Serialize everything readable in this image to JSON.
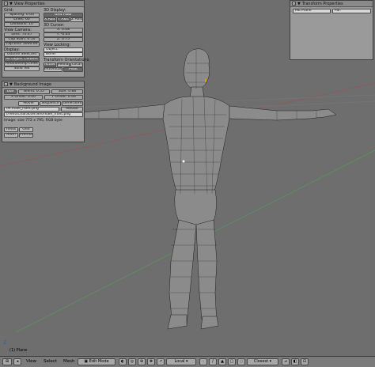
{
  "view_properties": {
    "title": "View Properties",
    "grid_section": "Grid:",
    "spacing": "Spacing: 0.00",
    "lines": "Lines: 60",
    "divisions": "Divisions: 10",
    "view_camera_section": "View Camera:",
    "lens": "Lens: 70.47",
    "clip_start": "Clip Start: 0.10",
    "clip_end": "Clip End: 5000.00",
    "display_section": "Display:",
    "outline_selected": "Outline Selected",
    "all_object_centers": "All Object Centers",
    "relationship_lines": "Relationship Lines",
    "solid_tex": "Solid Tex",
    "display3d_section": "3D Display:",
    "grid_floor": "Grid Floor",
    "x_axis": "X Axis",
    "y_axis": "Y Axis",
    "z_axis": "Z Axis",
    "cursor_section": "3D Cursor:",
    "cursor_x": "X: 0.08",
    "cursor_y": "Y: -0.03",
    "cursor_z": "Z: 0.75",
    "view_locking_section": "View Locking:",
    "object": "Object:",
    "bone": "Bone:",
    "transform_orientations_section": "Transform Orientations:",
    "active": "Active",
    "median": "Median",
    "local": "Local",
    "indiv": "Individual",
    "pivot": "Pivot"
  },
  "background_image": {
    "title": "Background Image",
    "use": "Use",
    "blend": "Blend: 0.55",
    "size": "Size: 0.88",
    "x_offset": "X Offset: 0.00",
    "y_offset": "Y Offset: 0.06",
    "movie": "Movie",
    "sequence": "Sequence",
    "generated": "Generated",
    "img_name": "IM:male_front.png",
    "reload": "Reload",
    "path": "//rentsCharacter/Sm/male_front.png",
    "info": "Image: size 772 x 795, RGB byte",
    "fields": "Fields",
    "odd": "Odd",
    "anim": "Anim",
    "premul": "Premul"
  },
  "transform_properties": {
    "title": "Transform Properties",
    "plane_label": "ME:Plane",
    "par_label": "Par:"
  },
  "viewport": {
    "object_name": "(1) Plane",
    "axis_label": "Z"
  },
  "statusbar": {
    "view": "View",
    "select": "Select",
    "mesh": "Mesh",
    "mode": "Edit Mode",
    "orientation": "Local",
    "snap": "Closest"
  },
  "colors": {
    "viewport_bg": "#6e6e6e",
    "panel_bg": "#9a9a9a",
    "mesh_fill": "#8a8a8a",
    "mesh_wire": "#202020",
    "grid_red": "#a05050",
    "grid_green": "#5a9a5a"
  }
}
